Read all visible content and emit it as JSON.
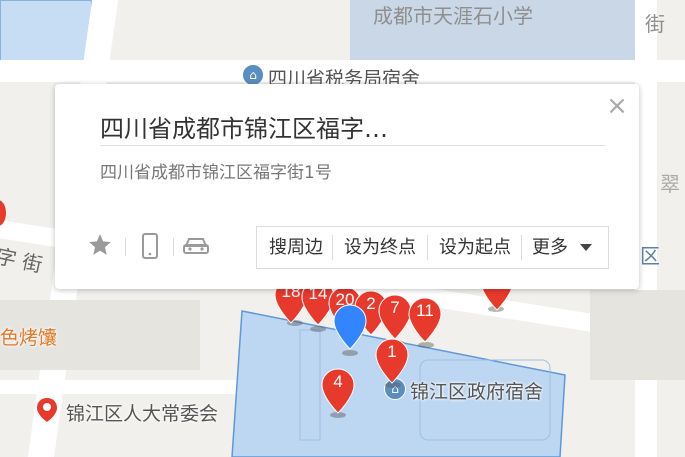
{
  "map": {
    "street_labels": [
      "成都市天涯石小学",
      "街",
      "翠",
      "字 街",
      "区"
    ],
    "pois": [
      {
        "label": "四川省税务局宿舍",
        "icon": "government-building-icon"
      },
      {
        "label": "锦江区政府宿舍",
        "icon": "government-building-icon"
      },
      {
        "label": "锦江区人大常委会",
        "icon": "location-pin-icon"
      },
      {
        "label": "色烤馕",
        "icon": ""
      }
    ],
    "markers": [
      "18",
      "14",
      "20",
      "2",
      "7",
      "11",
      "1",
      "4"
    ],
    "colors": {
      "marker": "#e8392d",
      "selected_marker": "#3385ff",
      "highlight": "#b8d4f2"
    }
  },
  "popup": {
    "title": "四川省成都市锦江区福字…",
    "address": "四川省成都市锦江区福字街1号",
    "close": "×",
    "actions": [
      "搜周边",
      "设为终点",
      "设为起点",
      "更多"
    ]
  }
}
